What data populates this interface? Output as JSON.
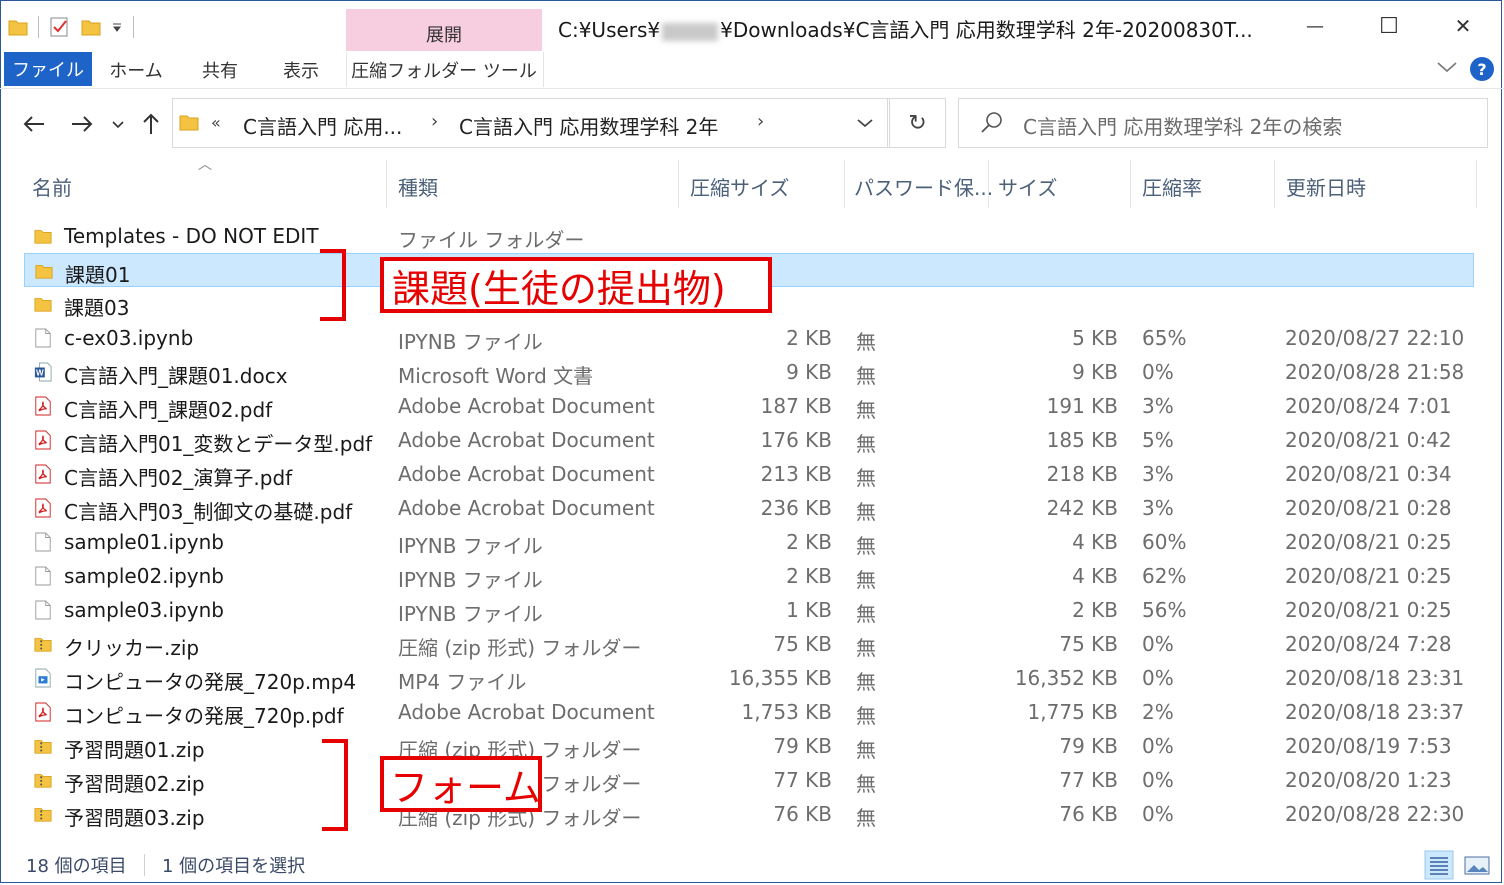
{
  "window": {
    "path_prefix": "C:¥Users¥",
    "path_suffix": "¥Downloads¥C言語入門 応用数理学科 2年-20200830T...",
    "minimize_glyph": "—",
    "maximize_glyph": "☐",
    "close_glyph": "✕"
  },
  "ribbon": {
    "context_group": "展開",
    "tabs": [
      "ファイル",
      "ホーム",
      "共有",
      "表示",
      "圧縮フォルダー ツール"
    ],
    "help": "?"
  },
  "address": {
    "overflow": "«",
    "crumbs": [
      "C言語入門 応用...",
      "C言語入門 応用数理学科 2年"
    ],
    "separator": "›",
    "refresh": "↻"
  },
  "search": {
    "placeholder": "C言語入門 応用数理学科 2年の検索"
  },
  "columns": [
    "名前",
    "種類",
    "圧縮サイズ",
    "パスワード保...",
    "サイズ",
    "圧縮率",
    "更新日時"
  ],
  "files": [
    {
      "name": "Templates - DO NOT EDIT",
      "type": "ファイル フォルダー",
      "csize": "",
      "pwd": "",
      "size": "",
      "ratio": "",
      "date": "",
      "icon": "folder-icon"
    },
    {
      "name": "課題01",
      "type": "",
      "csize": "",
      "pwd": "",
      "size": "",
      "ratio": "",
      "date": "",
      "icon": "folder-icon",
      "selected": true
    },
    {
      "name": "課題03",
      "type": "",
      "csize": "",
      "pwd": "",
      "size": "",
      "ratio": "",
      "date": "",
      "icon": "folder-icon"
    },
    {
      "name": "c-ex03.ipynb",
      "type": "IPYNB ファイル",
      "csize": "2 KB",
      "pwd": "無",
      "size": "5 KB",
      "ratio": "65%",
      "date": "2020/08/27 22:10",
      "icon": "document-icon"
    },
    {
      "name": "C言語入門_課題01.docx",
      "type": "Microsoft Word 文書",
      "csize": "9 KB",
      "pwd": "無",
      "size": "9 KB",
      "ratio": "0%",
      "date": "2020/08/28 21:58",
      "icon": "word-icon"
    },
    {
      "name": "C言語入門_課題02.pdf",
      "type": "Adobe Acrobat Document",
      "csize": "187 KB",
      "pwd": "無",
      "size": "191 KB",
      "ratio": "3%",
      "date": "2020/08/24 7:01",
      "icon": "pdf-icon"
    },
    {
      "name": "C言語入門01_変数とデータ型.pdf",
      "type": "Adobe Acrobat Document",
      "csize": "176 KB",
      "pwd": "無",
      "size": "185 KB",
      "ratio": "5%",
      "date": "2020/08/21 0:42",
      "icon": "pdf-icon"
    },
    {
      "name": "C言語入門02_演算子.pdf",
      "type": "Adobe Acrobat Document",
      "csize": "213 KB",
      "pwd": "無",
      "size": "218 KB",
      "ratio": "3%",
      "date": "2020/08/21 0:34",
      "icon": "pdf-icon"
    },
    {
      "name": "C言語入門03_制御文の基礎.pdf",
      "type": "Adobe Acrobat Document",
      "csize": "236 KB",
      "pwd": "無",
      "size": "242 KB",
      "ratio": "3%",
      "date": "2020/08/21 0:28",
      "icon": "pdf-icon"
    },
    {
      "name": "sample01.ipynb",
      "type": "IPYNB ファイル",
      "csize": "2 KB",
      "pwd": "無",
      "size": "4 KB",
      "ratio": "60%",
      "date": "2020/08/21 0:25",
      "icon": "document-icon"
    },
    {
      "name": "sample02.ipynb",
      "type": "IPYNB ファイル",
      "csize": "2 KB",
      "pwd": "無",
      "size": "4 KB",
      "ratio": "62%",
      "date": "2020/08/21 0:25",
      "icon": "document-icon"
    },
    {
      "name": "sample03.ipynb",
      "type": "IPYNB ファイル",
      "csize": "1 KB",
      "pwd": "無",
      "size": "2 KB",
      "ratio": "56%",
      "date": "2020/08/21 0:25",
      "icon": "document-icon"
    },
    {
      "name": "クリッカー.zip",
      "type": "圧縮 (zip 形式) フォルダー",
      "csize": "75 KB",
      "pwd": "無",
      "size": "75 KB",
      "ratio": "0%",
      "date": "2020/08/24 7:28",
      "icon": "zip-icon"
    },
    {
      "name": "コンピュータの発展_720p.mp4",
      "type": "MP4 ファイル",
      "csize": "16,355 KB",
      "pwd": "無",
      "size": "16,352 KB",
      "ratio": "0%",
      "date": "2020/08/18 23:31",
      "icon": "video-icon"
    },
    {
      "name": "コンピュータの発展_720p.pdf",
      "type": "Adobe Acrobat Document",
      "csize": "1,753 KB",
      "pwd": "無",
      "size": "1,775 KB",
      "ratio": "2%",
      "date": "2020/08/18 23:37",
      "icon": "pdf-icon"
    },
    {
      "name": "予習問題01.zip",
      "type": "圧縮 (zip 形式) フォルダー",
      "csize": "79 KB",
      "pwd": "無",
      "size": "79 KB",
      "ratio": "0%",
      "date": "2020/08/19 7:53",
      "icon": "zip-icon"
    },
    {
      "name": "予習問題02.zip",
      "type": "圧縮 (zip 形式) フォルダー",
      "csize": "77 KB",
      "pwd": "無",
      "size": "77 KB",
      "ratio": "0%",
      "date": "2020/08/20 1:23",
      "icon": "zip-icon"
    },
    {
      "name": "予習問題03.zip",
      "type": "圧縮 (zip 形式) フォルダー",
      "csize": "76 KB",
      "pwd": "無",
      "size": "76 KB",
      "ratio": "0%",
      "date": "2020/08/28 22:30",
      "icon": "zip-icon"
    }
  ],
  "status": {
    "count": "18 個の項目",
    "selected": "1 個の項目を選択"
  },
  "annotations": [
    {
      "text": "課題(生徒の提出物)"
    },
    {
      "text": "フォーム"
    }
  ],
  "colors": {
    "accent": "#1e64c8",
    "selection": "#cce8ff",
    "annotation": "#e60000",
    "context_tab": "#f7cee0"
  }
}
